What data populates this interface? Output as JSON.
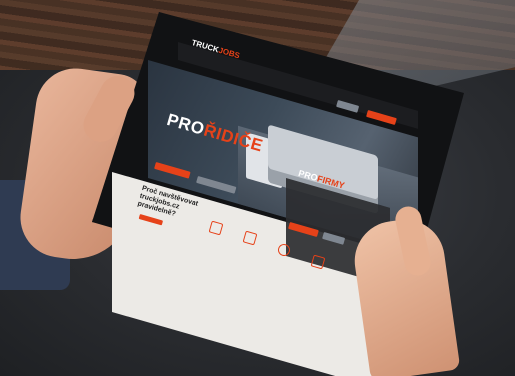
{
  "scene": {
    "description_label": "tablet-photo"
  },
  "website": {
    "logo": {
      "main": "TRUCK",
      "accent": "JOBS"
    },
    "hero_title": {
      "prefix": "PRO",
      "accent": "ŘIDIČE"
    },
    "firm_title": {
      "prefix": "PRO",
      "accent": "FIRMY"
    },
    "why_heading": "Proč navštěvovat truckjobs.cz pravidelně?"
  },
  "colors": {
    "accent": "#e64219",
    "screen_dark": "#1c1d20",
    "screen_light": "#eceae6"
  }
}
